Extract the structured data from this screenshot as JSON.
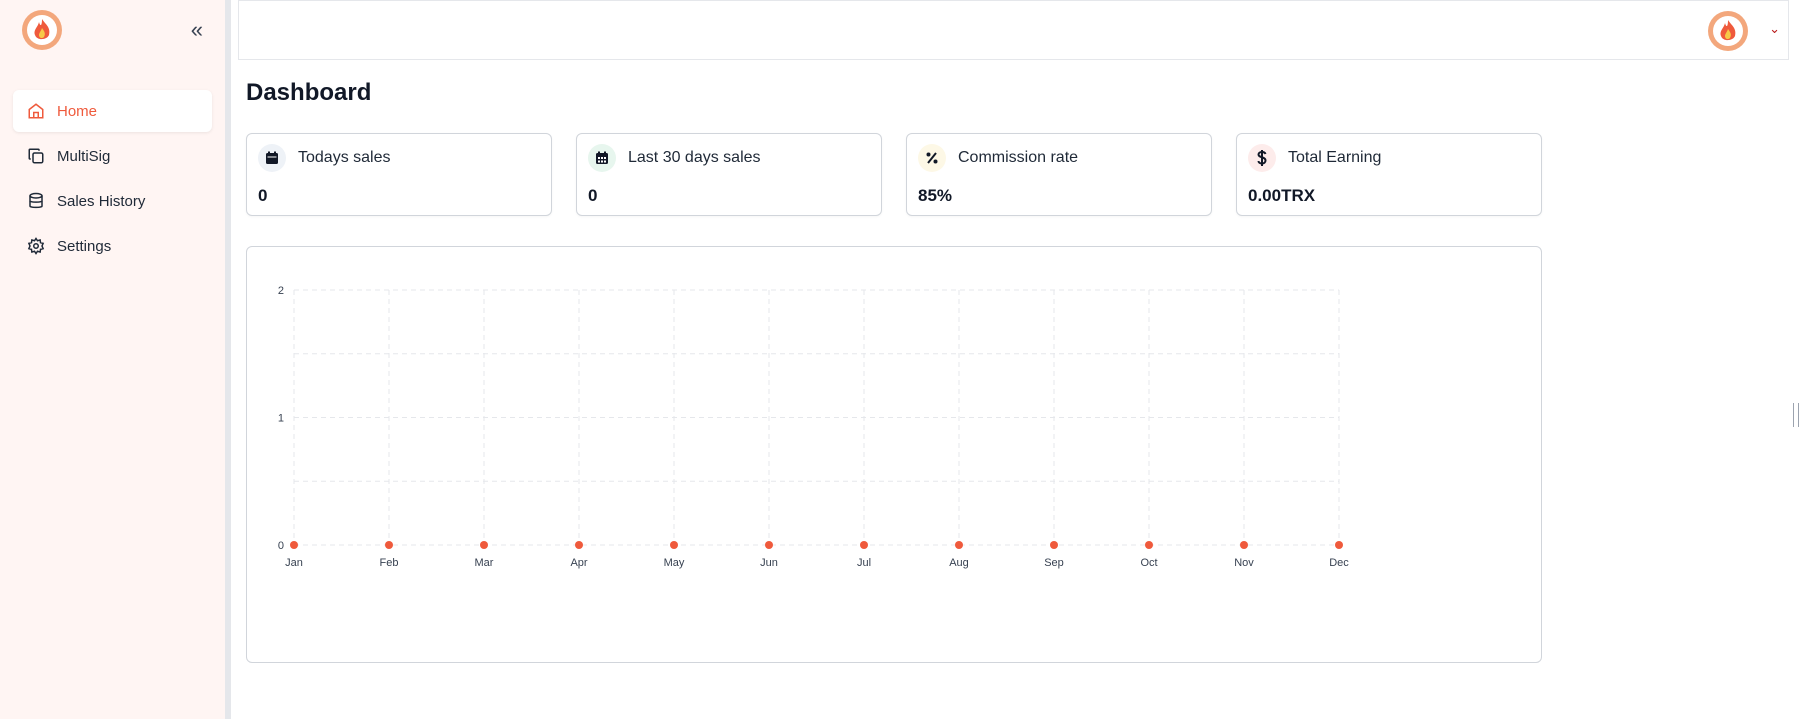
{
  "sidebar": {
    "collapse_glyph": "«",
    "items": [
      {
        "label": "Home",
        "icon": "home-icon",
        "active": true
      },
      {
        "label": "MultiSig",
        "icon": "copy-icon",
        "active": false
      },
      {
        "label": "Sales History",
        "icon": "database-icon",
        "active": false
      },
      {
        "label": "Settings",
        "icon": "gear-icon",
        "active": false
      }
    ]
  },
  "header": {
    "caret_glyph": "⌄"
  },
  "main": {
    "title": "Dashboard",
    "cards": [
      {
        "label": "Todays sales",
        "value": "0",
        "icon": "calendar-icon",
        "icon_bg": "#eef2f7",
        "icon_color": "#111827"
      },
      {
        "label": "Last 30 days sales",
        "value": "0",
        "icon": "calendar-grid-icon",
        "icon_bg": "#e7f6ee",
        "icon_color": "#111827"
      },
      {
        "label": "Commission rate",
        "value": "85%",
        "icon": "percent-icon",
        "icon_bg": "#fdf8e6",
        "icon_color": "#111827"
      },
      {
        "label": "Total Earning",
        "value": "0.00TRX",
        "icon": "dollar-icon",
        "icon_bg": "#fdeceb",
        "icon_color": "#111827"
      }
    ]
  },
  "colors": {
    "accent": "#ef5a3c",
    "line_start": "#f7c948",
    "line_end": "#ef5a3c",
    "point": "#ef5a3c"
  },
  "chart_data": {
    "type": "line",
    "categories": [
      "Jan",
      "Feb",
      "Mar",
      "Apr",
      "May",
      "Jun",
      "Jul",
      "Aug",
      "Sep",
      "Oct",
      "Nov",
      "Dec"
    ],
    "series": [
      {
        "values": [
          0,
          0,
          0,
          0,
          0,
          0,
          0,
          0,
          0,
          0,
          0,
          0
        ]
      }
    ],
    "ylim": [
      0,
      2
    ],
    "yticks": [
      "0",
      "1",
      "2"
    ],
    "grid": true,
    "title": "",
    "xlabel": "",
    "ylabel": ""
  }
}
